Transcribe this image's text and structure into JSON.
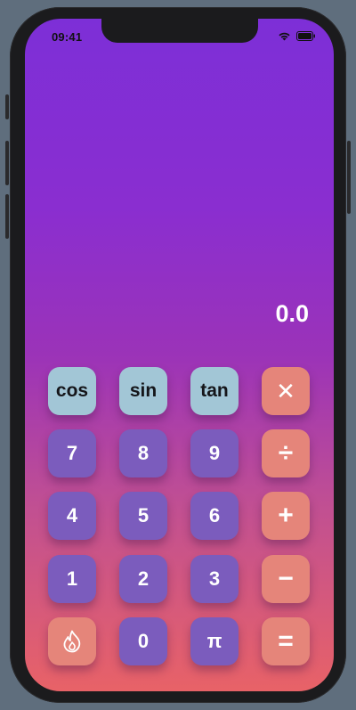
{
  "status_bar": {
    "time": "09:41",
    "icons": [
      "wifi-icon",
      "battery-icon"
    ]
  },
  "display": {
    "value": "0.0"
  },
  "keys": {
    "cos": "cos",
    "sin": "sin",
    "tan": "tan",
    "clear": "✕",
    "seven": "7",
    "eight": "8",
    "nine": "9",
    "divide": "÷",
    "four": "4",
    "five": "5",
    "six": "6",
    "plus": "+",
    "one": "1",
    "two": "2",
    "three": "3",
    "minus": "−",
    "zero": "0",
    "pi": "π",
    "equals": "="
  },
  "special_key_icon": "flame-icon",
  "colors": {
    "gradient_top": "#7d2fd7",
    "gradient_bottom": "#e86267",
    "number_key": "#7b5cbd",
    "operator_key": "#e5857a",
    "function_key": "#a2c6d6"
  }
}
